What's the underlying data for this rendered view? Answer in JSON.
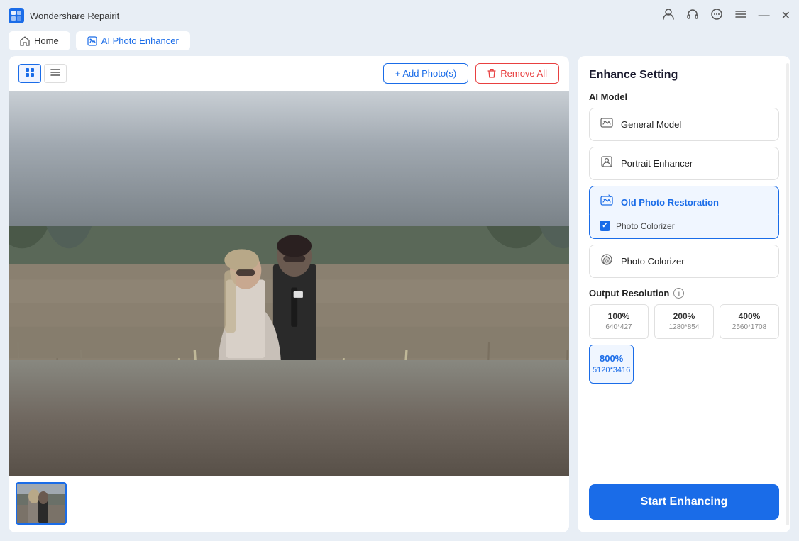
{
  "app": {
    "title": "Wondershare Repairit",
    "icon_label": "W"
  },
  "titlebar": {
    "profile_icon": "👤",
    "headphone_icon": "🎧",
    "chat_icon": "💬",
    "menu_icon": "☰",
    "minimize_icon": "—",
    "close_icon": "✕"
  },
  "nav": {
    "home_label": "Home",
    "active_label": "AI Photo Enhancer"
  },
  "toolbar": {
    "add_label": "+ Add Photo(s)",
    "remove_label": "Remove All"
  },
  "enhance_setting": {
    "title": "Enhance Setting",
    "ai_model_label": "AI Model",
    "models": [
      {
        "id": "general",
        "label": "General Model",
        "active": false
      },
      {
        "id": "portrait",
        "label": "Portrait Enhancer",
        "active": false
      },
      {
        "id": "old_photo",
        "label": "Old Photo Restoration",
        "active": true
      },
      {
        "id": "colorizer",
        "label": "Photo Colorizer",
        "active": false
      }
    ],
    "photo_colorizer_checkbox_label": "Photo Colorizer",
    "output_resolution_label": "Output Resolution",
    "resolutions": [
      {
        "pct": "100%",
        "size": "640*427"
      },
      {
        "pct": "200%",
        "size": "1280*854"
      },
      {
        "pct": "400%",
        "size": "2560*1708"
      }
    ],
    "selected_resolution": {
      "pct": "800%",
      "size": "5120*3416"
    },
    "start_button_label": "Start Enhancing"
  }
}
